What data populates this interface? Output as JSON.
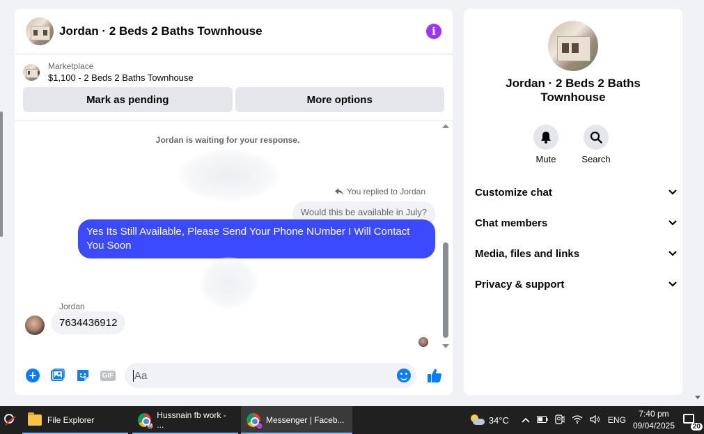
{
  "chat": {
    "title": "Jordan · 2 Beds 2 Baths Townhouse",
    "listing": {
      "source": "Marketplace",
      "price_title": "$1,100 - 2 Beds 2 Baths Townhouse",
      "mark_pending": "Mark as pending",
      "more_options": "More options"
    },
    "messages": {
      "waiting": "Jordan is waiting for your response.",
      "replied_to": "You replied to Jordan",
      "quoted": "Would this be available in July?",
      "outgoing": "Yes Its Still Available, Please Send Your Phone NUmber I Will Contact You Soon",
      "incoming_name": "Jordan",
      "incoming": "7634436912"
    },
    "composer": {
      "placeholder": "Aa",
      "gif": "GIF"
    }
  },
  "info_panel": {
    "title": "Jordan · 2 Beds 2 Baths Townhouse",
    "actions": [
      {
        "label": "Mute",
        "icon": "bell-icon"
      },
      {
        "label": "Search",
        "icon": "search-icon"
      }
    ],
    "sections": [
      "Customize chat",
      "Chat members",
      "Media, files and links",
      "Privacy & support"
    ]
  },
  "taskbar": {
    "apps": [
      {
        "label": "File Explorer",
        "icon": "folder-icon"
      },
      {
        "label": "Hussnain fb work - ...",
        "icon": "chrome-icon",
        "badge": "M"
      },
      {
        "label": "Messenger | Faceb...",
        "icon": "chrome-icon",
        "active": true
      }
    ],
    "weather": "34°C",
    "language": "ENG",
    "time": "7:40 pm",
    "date": "09/04/2025",
    "notifications": "20"
  },
  "colors": {
    "accent": "#0a7cff",
    "outgoing_bubble": "#3b49ff",
    "info_icon": "#a033ff"
  }
}
